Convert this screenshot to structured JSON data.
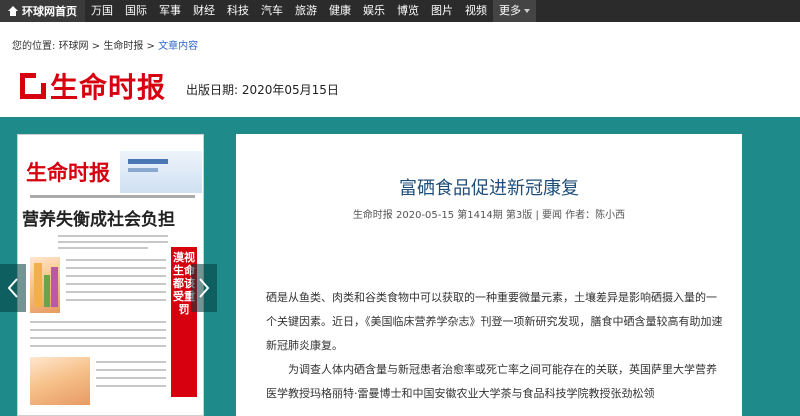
{
  "nav": {
    "home": "环球网首页",
    "items": [
      "万国",
      "国际",
      "军事",
      "财经",
      "科技",
      "汽车",
      "旅游",
      "健康",
      "娱乐",
      "博览",
      "图片",
      "视频"
    ],
    "more": "更多"
  },
  "breadcrumb": {
    "prefix": "您的位置:",
    "crumb1": "环球网",
    "sep": ">",
    "crumb2": "生命时报",
    "crumb3": "文章内容"
  },
  "masthead": {
    "logo": "生命时报",
    "pubdate": "出版日期: 2020年05月15日"
  },
  "paper": {
    "title": "生命时报",
    "headline": "营养失衡成社会负担",
    "side_column": "漠视生命都该受重罚"
  },
  "article": {
    "title": "富硒食品促进新冠康复",
    "meta": "生命时报   2020-05-15 第1414期   第3版   |   要闻 作者：陈小西",
    "para1": "硒是从鱼类、肉类和谷类食物中可以获取的一种重要微量元素，土壤差异是影响硒摄入量的一个关键因素。近日，《美国临床营养学杂志》刊登一项新研究发现，膳食中硒含量较高有助加速新冠肺炎康复。",
    "para2": "为调查人体内硒含量与新冠患者治愈率或死亡率之间可能存在的关联，英国萨里大学营养医学教授玛格丽特·雷曼博士和中国安徽农业大学茶与食品科技学院教授张劲松领"
  },
  "colors": {
    "teal": "#1f8a8a",
    "brand_red": "#d7000f",
    "title_blue": "#1f4e79"
  },
  "icons": {
    "prev": "chevron-left-icon",
    "next": "chevron-right-icon",
    "home": "home-icon",
    "more": "caret-down-icon"
  }
}
